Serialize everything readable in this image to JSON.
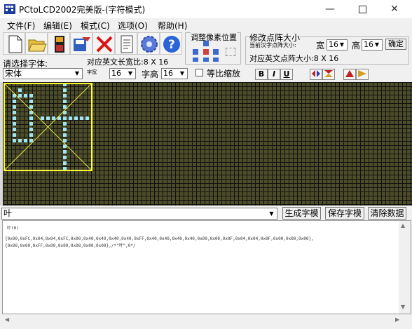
{
  "window": {
    "title": "PCtoLCD2002完美版-(字符模式)"
  },
  "menu": [
    "文件(F)",
    "编辑(E)",
    "模式(C)",
    "选项(O)",
    "帮助(H)"
  ],
  "toolbar_icons": [
    "new-file-icon",
    "open-folder-icon",
    "save-disk-icon",
    "export-disk-icon",
    "delete-x-icon",
    "notepad-icon",
    "settings-gear-icon",
    "help-question-icon"
  ],
  "adjust": {
    "title": "调整像素位置"
  },
  "matrix": {
    "title": "修改点阵大小",
    "current_label": "当前汉字点阵大小:",
    "width_label": "宽",
    "width_value": "16",
    "height_label": "高",
    "height_value": "16",
    "confirm_label": "确定",
    "en_size_label": "对应英文点阵大小:8 X 16"
  },
  "font": {
    "select_label": "请选择字体:",
    "font_value": "宋体",
    "en_width_label": "对应英文长宽比:8 X 16",
    "char_width_label": "字宽",
    "char_width_value": "16",
    "char_height_label": "字高",
    "char_height_value": "16",
    "scale_label": "等比缩放",
    "bold": "B",
    "italic": "I",
    "underline": "U"
  },
  "input": {
    "text": "叶"
  },
  "buttons": {
    "generate": "生成字模",
    "save": "保存字模",
    "clear": "清除数据"
  },
  "output": {
    "line1": "叶(0)",
    "line2": "{0x00,0xFC,0x04,0x04,0xFC,0x00,0x40,0x40,0x40,0x40,0xFF,0x40,0x40,0x40,0x40,0x00,0x00,0x0F,0x04,0x04,0x0F,0x00,0x00,0x00},",
    "line3": "{0x00,0x00,0xFF,0x00,0x00,0x00,0x00,0x00},/*\"叶\",0*/"
  }
}
